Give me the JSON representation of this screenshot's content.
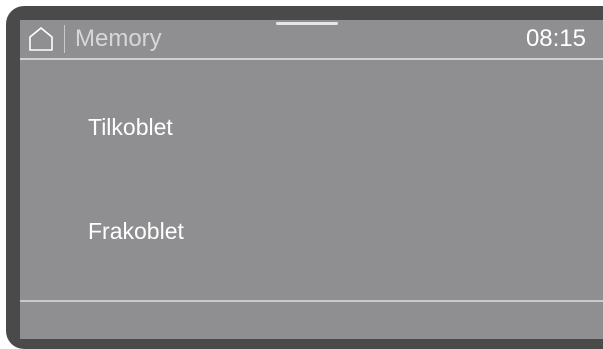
{
  "header": {
    "home_icon": "home-icon",
    "title": "Memory",
    "clock": "08:15"
  },
  "menu": {
    "items": [
      {
        "label": "Tilkoblet"
      },
      {
        "label": "Frakoblet"
      }
    ]
  },
  "colors": {
    "bezel": "#4a4a4a",
    "screen": "#8f8f91",
    "text": "#ffffff",
    "title_text": "#d7d7d9",
    "divider": "#d0d0d2"
  }
}
